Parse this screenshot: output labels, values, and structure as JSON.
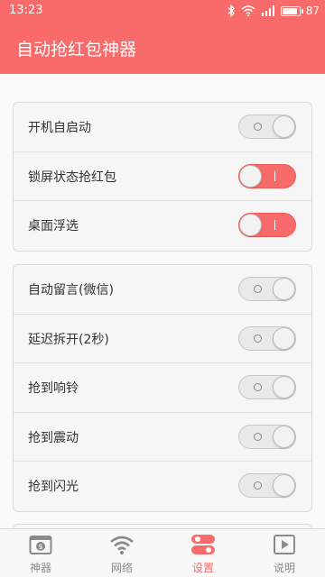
{
  "status_bar": {
    "time": "13:23",
    "battery_level": "87",
    "battery_fraction": 0.87
  },
  "app_bar": {
    "title": "自动抢红包神器"
  },
  "settings": {
    "group1": [
      {
        "label": "开机自启动",
        "on": false
      },
      {
        "label": "锁屏状态抢红包",
        "on": true
      },
      {
        "label": "桌面浮选",
        "on": true
      }
    ],
    "group2": [
      {
        "label": "自动留言(微信)",
        "on": false
      },
      {
        "label": "延迟拆开(2秒)",
        "on": false
      },
      {
        "label": "抢到响铃",
        "on": false
      },
      {
        "label": "抢到震动",
        "on": false
      },
      {
        "label": "抢到闪光",
        "on": false
      }
    ]
  },
  "tabs": [
    {
      "label": "神器",
      "icon": "wallet-icon",
      "active": false
    },
    {
      "label": "网络",
      "icon": "wifi-icon",
      "active": false
    },
    {
      "label": "设置",
      "icon": "settings-toggle-icon",
      "active": true
    },
    {
      "label": "说明",
      "icon": "play-doc-icon",
      "active": false
    }
  ],
  "colors": {
    "accent": "#f96a6a",
    "tab_inactive": "#8a8a8a"
  }
}
